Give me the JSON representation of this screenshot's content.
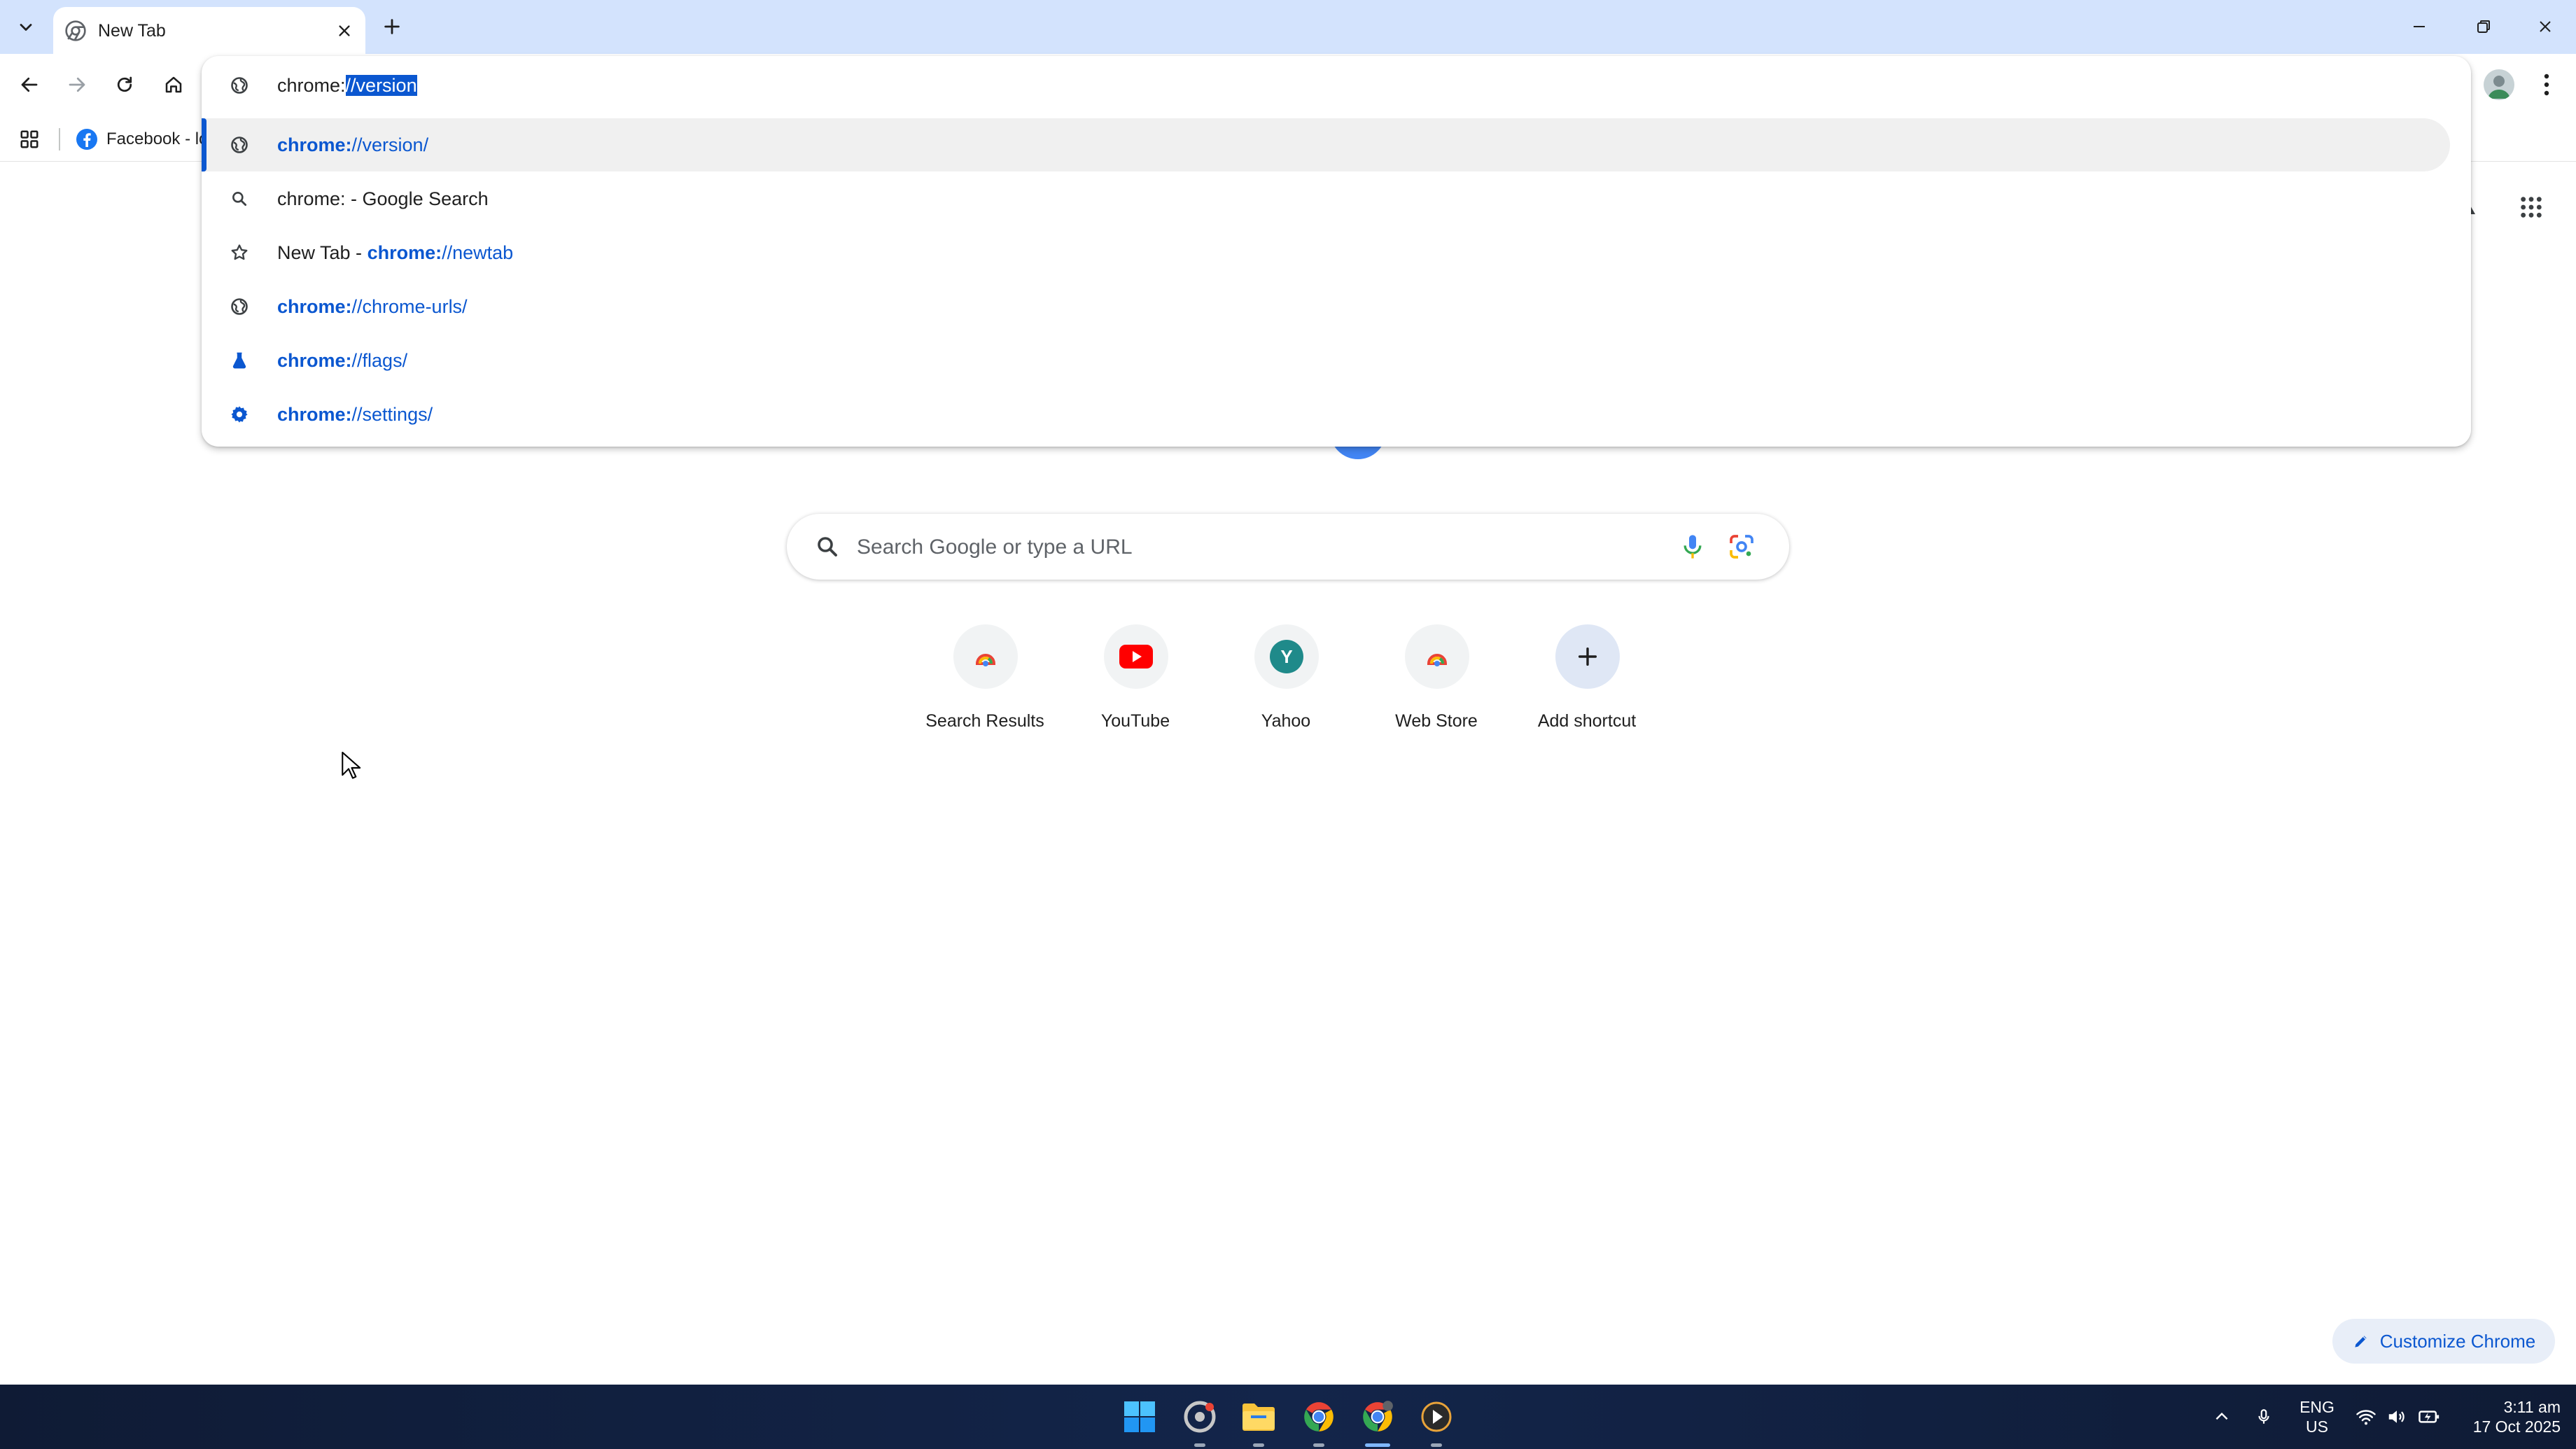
{
  "tab": {
    "title": "New Tab",
    "close_symbol": "✕",
    "new_tab_symbol": "+"
  },
  "window_controls": {
    "minimize_symbol": "—",
    "maximize_symbol": "❐",
    "close_symbol": "✕"
  },
  "bookmarks": {
    "items": [
      {
        "label": "Facebook - lo",
        "icon": "facebook-icon"
      }
    ]
  },
  "omnibox": {
    "input_typed": "chrome:",
    "input_selected": "//version",
    "suggestions": [
      {
        "icon": "globe-icon",
        "prefix": "",
        "url_bold": "chrome:",
        "url_rest": "//version/",
        "suffix": "",
        "highlighted": true
      },
      {
        "icon": "search-icon",
        "prefix": "chrome: - Google Search",
        "url_bold": "",
        "url_rest": "",
        "suffix": "",
        "highlighted": false
      },
      {
        "icon": "star-icon",
        "prefix": "New Tab - ",
        "url_bold": "chrome:",
        "url_rest": "//newtab",
        "suffix": "",
        "highlighted": false
      },
      {
        "icon": "globe-icon",
        "prefix": "",
        "url_bold": "chrome:",
        "url_rest": "//chrome-urls/",
        "suffix": "",
        "highlighted": false
      },
      {
        "icon": "flask-icon",
        "prefix": "",
        "url_bold": "chrome:",
        "url_rest": "//flags/",
        "suffix": "",
        "highlighted": false
      },
      {
        "icon": "gear-icon",
        "prefix": "",
        "url_bold": "chrome:",
        "url_rest": "//settings/",
        "suffix": "",
        "highlighted": false
      }
    ]
  },
  "ntp": {
    "search_placeholder": "Search Google or type a URL",
    "shortcuts": [
      {
        "label": "Search Results",
        "icon": "chrome-webstore-icon"
      },
      {
        "label": "YouTube",
        "icon": "youtube-icon"
      },
      {
        "label": "Yahoo",
        "icon": "yahoo-icon",
        "letter": "Y"
      },
      {
        "label": "Web Store",
        "icon": "chrome-webstore-icon"
      },
      {
        "label": "Add shortcut",
        "icon": "plus-icon",
        "letter": "+"
      }
    ],
    "customize_label": "Customize Chrome"
  },
  "taskbar": {
    "language_top": "ENG",
    "language_bottom": "US",
    "time": "3:11 am",
    "date": "17 Oct 2025"
  },
  "colors": {
    "accent": "#0b57d0",
    "tabstrip": "#d3e3fd",
    "youtube_red": "#ff0000",
    "yahoo_teal": "#1f8a8a"
  }
}
